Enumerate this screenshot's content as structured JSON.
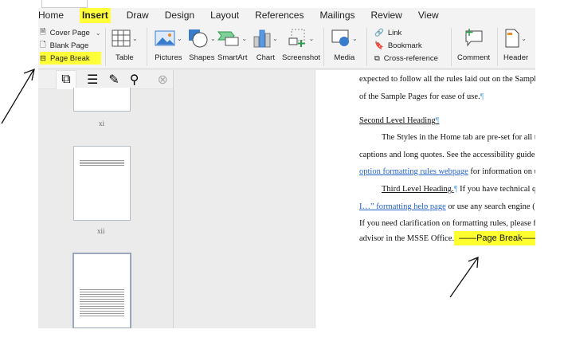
{
  "tabs": [
    "Home",
    "Insert",
    "Draw",
    "Design",
    "Layout",
    "References",
    "Mailings",
    "Review",
    "View"
  ],
  "active_tab": "Insert",
  "ribbon": {
    "pages": [
      "Cover Page",
      "Blank Page",
      "Page Break"
    ],
    "table": "Table",
    "pictures": "Pictures",
    "shapes": "Shapes",
    "smartart": "SmartArt",
    "chart": "Chart",
    "screenshot": "Screenshot",
    "media": "Media",
    "links": [
      "Link",
      "Bookmark",
      "Cross-reference"
    ],
    "comment": "Comment",
    "header": "Header"
  },
  "sidebar": {
    "page_labels": [
      "xi",
      "xii"
    ]
  },
  "document": {
    "lines": [
      "expected to follow all the rules laid out on the Sample Page",
      "of the Sample Pages for ease of use.",
      "Second Level Heading",
      "The Styles in the Home tab are pre-set for all titles",
      "captions and long quotes. See the accessibility guidelines a",
      "option formatting rules webpage",
      " for information on using t",
      "Third Level Heading.",
      " If you have technical questi",
      "I…” formatting help page",
      " or use any search engine (such a",
      "If you need clarification on formatting rules, please feel fre",
      "advisor in the MSSE Office."
    ],
    "page_break": "Page Break"
  },
  "colors": {
    "highlight": "#ffff3a",
    "link": "#2563c9",
    "accent": "#2b7a1f"
  }
}
